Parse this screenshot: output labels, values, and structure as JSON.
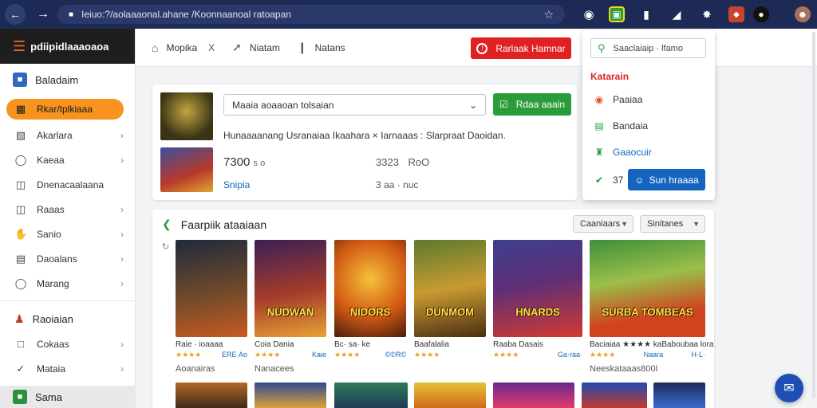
{
  "browser": {
    "url": "ƒıaaa?/ƒahalaaaaabı ıııalıı ııı/ıbahaaad abaaaıa",
    "url_display": "Ieiuo:?/aolaaaonal.ahane /Koonnaanoal ratoapan"
  },
  "sidebar": {
    "brand": "pdiipidlaaaoaoa",
    "head1": "Baladaim",
    "items": [
      {
        "label": "Rkar/tplkiaaa",
        "icon": "grid-icon"
      },
      {
        "label": "Akarlara",
        "icon": "chart-icon"
      },
      {
        "label": "Kaeaa",
        "icon": "controller-icon"
      },
      {
        "label": "Dnenacaalaana",
        "icon": "tag-icon"
      },
      {
        "label": "Raaas",
        "icon": "inbox-icon"
      },
      {
        "label": "Sanio",
        "icon": "hand-icon"
      },
      {
        "label": "Daoalans",
        "icon": "doc-icon"
      },
      {
        "label": "Marang",
        "icon": "chat-icon"
      }
    ],
    "head2": "Raoiaian",
    "items2": [
      {
        "label": "Cokaas",
        "icon": "box-icon"
      },
      {
        "label": "Mataia",
        "icon": "check-icon"
      }
    ],
    "bottom": "Sama"
  },
  "header": {
    "nav": [
      {
        "label": "Mopika",
        "icon": "home-icon"
      },
      {
        "label": "Niatam",
        "icon": "plane-icon"
      },
      {
        "label": "Natans",
        "icon": "lamp-icon"
      }
    ],
    "extra": "X",
    "red_button": "Rarlaak Hamnar"
  },
  "card1": {
    "select_value": "Maaia aoaaoan tolsaian",
    "green_button": "Rdaa aaain",
    "line": "Hunaaaanang Usranaiaa  Ikaahara  × Iarnaaas :  Slarpraat Daoidan.",
    "price1": "7300",
    "price1_suffix": "s o",
    "price2": "3323",
    "price2_suffix": "RoO",
    "link": "Snipia",
    "price3": "3 aa · nuc"
  },
  "dropdown": {
    "search_placeholder": "Saaclaiaip · lfamo",
    "category": "Katarain",
    "items": [
      {
        "label": "Paaiaa",
        "icon": "ring-icon"
      },
      {
        "label": "Bandaia",
        "icon": "bag-icon"
      },
      {
        "label": "Gaaocuir",
        "icon": "trophy-icon"
      }
    ],
    "count": "37",
    "button": "Sun hraaaa"
  },
  "card2": {
    "title": "Faarpiik ataaiaan",
    "filter1": "Caaniaars",
    "filter2": "Sinitanes",
    "under_left": "Aoanairas",
    "under_mid": "Nanacees",
    "under_right": "Neeskataaas800I",
    "games": [
      {
        "name": "Raie · ioaaaa",
        "stars": "★★★★",
        "price": "ERE Ao"
      },
      {
        "name": "Coia  Dania",
        "stars": "★★★★",
        "price": "Kaie"
      },
      {
        "name": "Bc· sa· ke",
        "stars": "★★★★",
        "price": "©©R©"
      },
      {
        "name": "Baafalalia",
        "stars": "★★★★",
        "price": ""
      },
      {
        "name": "Raaba  Dasais",
        "stars": "★★★★",
        "price": "Ga·raa·"
      },
      {
        "name": "Baciaiaa  ★★★★ ka",
        "stars": "★★★★",
        "price": "Naara"
      },
      {
        "name": "Baboubaa lora",
        "stars": "★★★★",
        "price": "H·L·"
      }
    ],
    "art_titles": [
      "",
      "NUDWAN",
      "NIDORS",
      "DUNMOM",
      "HNARDS",
      "SURBA TOMBEAS",
      ""
    ]
  },
  "colors": {
    "topbar": "#1c2a55",
    "accent_orange": "#f7931e",
    "red": "#e02121",
    "green": "#2a9d3a",
    "blue": "#1565c0"
  }
}
